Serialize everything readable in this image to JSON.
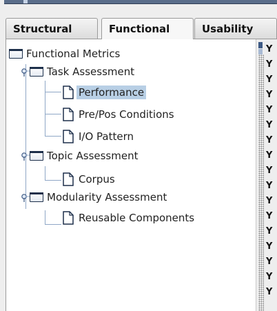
{
  "tabs": [
    {
      "label": "Structural",
      "active": false
    },
    {
      "label": "Functional",
      "active": true
    },
    {
      "label": "Usability",
      "active": false
    }
  ],
  "tree": {
    "root": "Functional Metrics",
    "groups": [
      {
        "label": "Task Assessment",
        "children": [
          "Performance",
          "Pre/Pos Conditions",
          "I/O Pattern"
        ]
      },
      {
        "label": "Topic Assessment",
        "children": [
          "Corpus"
        ]
      },
      {
        "label": "Modularity Assessment",
        "children": [
          "Reusable Components"
        ]
      }
    ],
    "selected": "Performance"
  },
  "side_glyphs": [
    "Y",
    "Y",
    "Y",
    "Y",
    "Y",
    "Y",
    "Y",
    "Y",
    "Y",
    "Y",
    "Y",
    "Y",
    "Y",
    "Y",
    "Y",
    "Y",
    "Y"
  ],
  "colors": {
    "selection": "#b8cfe5",
    "tree_lines": "#8fa7c6",
    "folder_outline": "#1d2f4a"
  }
}
